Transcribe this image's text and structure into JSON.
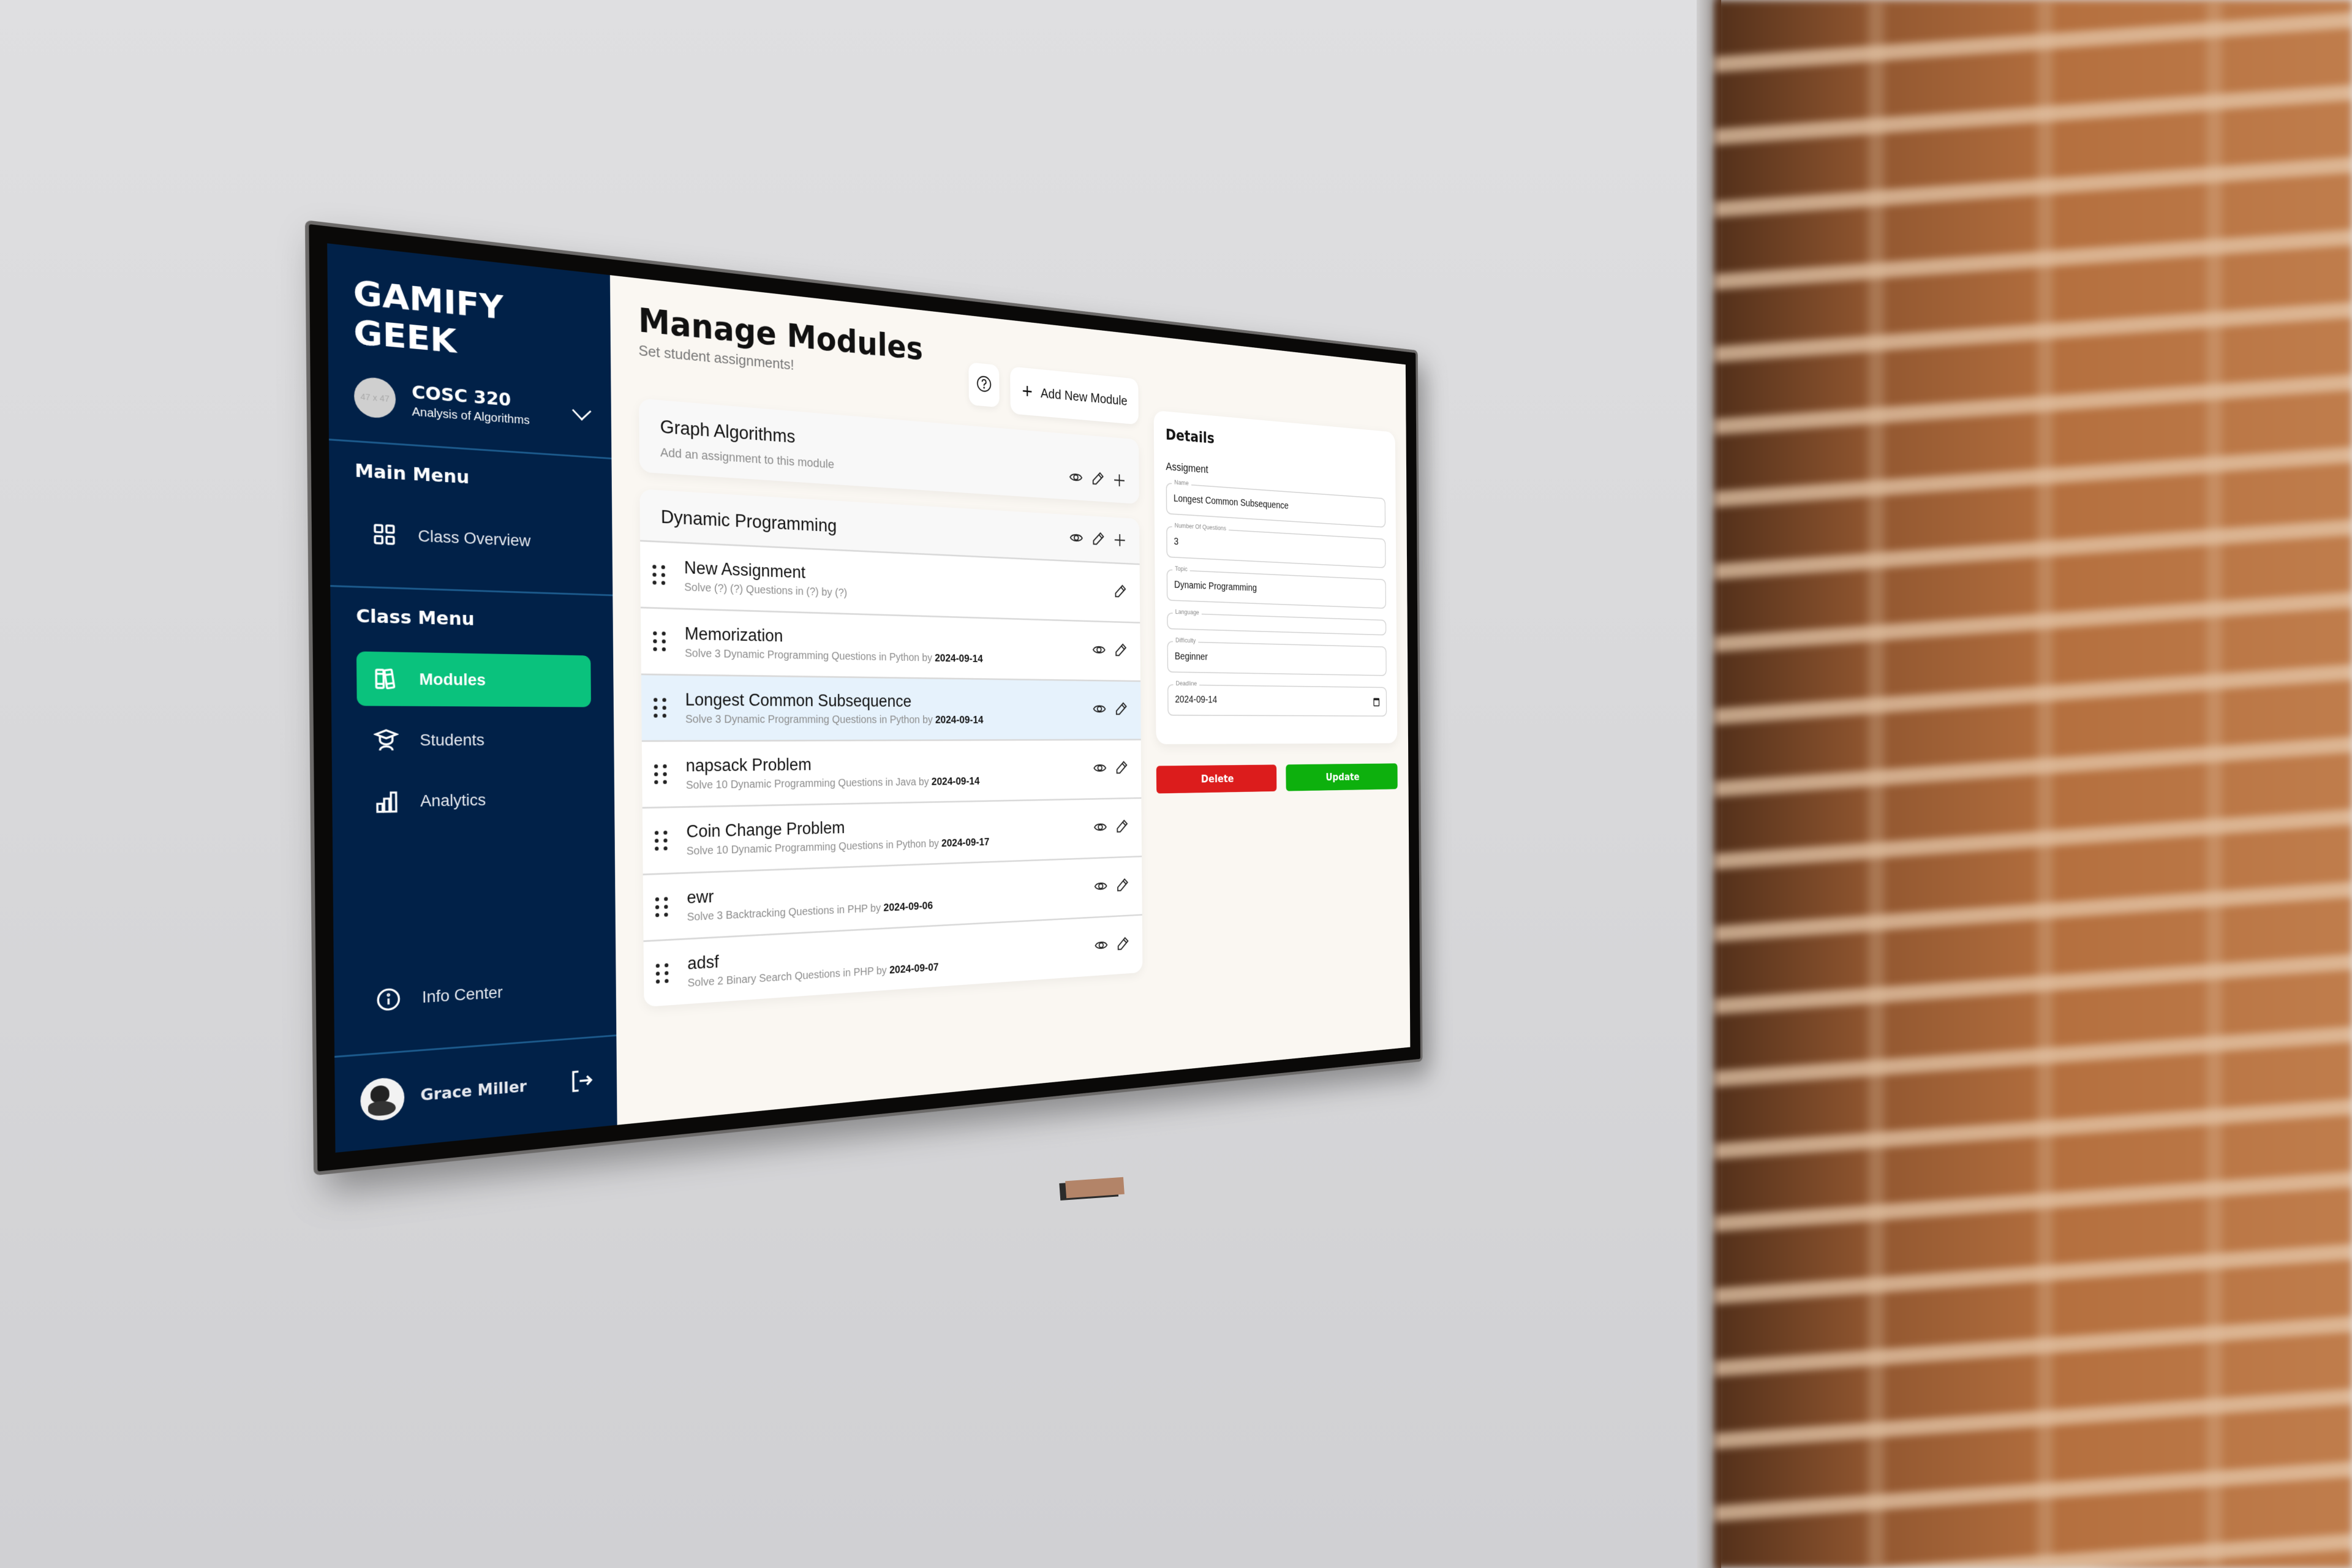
{
  "app": {
    "brand": "GAMIFY GEEK"
  },
  "course": {
    "avatar_placeholder": "47 x 47",
    "code": "COSC 320",
    "name": "Analysis of Algorithms"
  },
  "sidebar": {
    "main_menu_heading": "Main Menu",
    "main_menu": [
      {
        "label": "Class Overview",
        "icon": "grid-icon"
      }
    ],
    "class_menu_heading": "Class Menu",
    "class_menu": [
      {
        "label": "Modules",
        "icon": "books-icon",
        "active": true
      },
      {
        "label": "Students",
        "icon": "graduate-icon",
        "active": false
      },
      {
        "label": "Analytics",
        "icon": "bar-chart-icon",
        "active": false
      }
    ],
    "info_center": "Info Center",
    "user_name": "Grace Miller"
  },
  "header": {
    "title": "Manage Modules",
    "subtitle": "Set student assignments!",
    "add_module_label": "Add New Module"
  },
  "modules": [
    {
      "title": "Graph Algorithms",
      "subtitle": "Add an assignment to this module",
      "assignments": []
    },
    {
      "title": "Dynamic Programming",
      "subtitle": "",
      "assignments": [
        {
          "title": "New Assignment",
          "desc": "Solve (?) (?) Questions in (?) by (?)",
          "date": "",
          "selected": false,
          "has_view": false
        },
        {
          "title": "Memorization",
          "desc": "Solve 3 Dynamic Programming Questions in Python by",
          "date": "2024-09-14",
          "selected": false,
          "has_view": true
        },
        {
          "title": "Longest Common Subsequence",
          "desc": "Solve 3 Dynamic Programming Questions in Python by",
          "date": "2024-09-14",
          "selected": true,
          "has_view": true
        },
        {
          "title": "napsack Problem",
          "desc": "Solve 10 Dynamic Programming Questions in Java by",
          "date": "2024-09-14",
          "selected": false,
          "has_view": true
        },
        {
          "title": "Coin Change Problem",
          "desc": "Solve 10 Dynamic Programming Questions in Python by",
          "date": "2024-09-17",
          "selected": false,
          "has_view": true
        },
        {
          "title": "ewr",
          "desc": "Solve 3 Backtracking Questions in PHP by",
          "date": "2024-09-06",
          "selected": false,
          "has_view": true
        },
        {
          "title": "adsf",
          "desc": "Solve 2 Binary Search Questions in PHP by",
          "date": "2024-09-07",
          "selected": false,
          "has_view": true
        }
      ]
    }
  ],
  "details": {
    "title": "Details",
    "section": "Assigment",
    "fields": {
      "name": {
        "label": "Name",
        "value": "Longest Common Subsequence"
      },
      "num_questions": {
        "label": "Number Of Questions",
        "value": "3"
      },
      "topic": {
        "label": "Topic",
        "value": "Dynamic Programming"
      },
      "language": {
        "label": "Language",
        "value": ""
      },
      "difficulty": {
        "label": "Difficulty",
        "value": "Beginner"
      },
      "deadline": {
        "label": "Deadline",
        "value": "2024-09-14"
      }
    },
    "delete_label": "Delete",
    "update_label": "Update"
  },
  "colors": {
    "sidebar_bg": "#012148",
    "active_green": "#0ac27d",
    "delete_red": "#dc1c1c",
    "update_green": "#0db00d",
    "selected_row": "#e6f2fc",
    "content_bg": "#faf7f2"
  }
}
